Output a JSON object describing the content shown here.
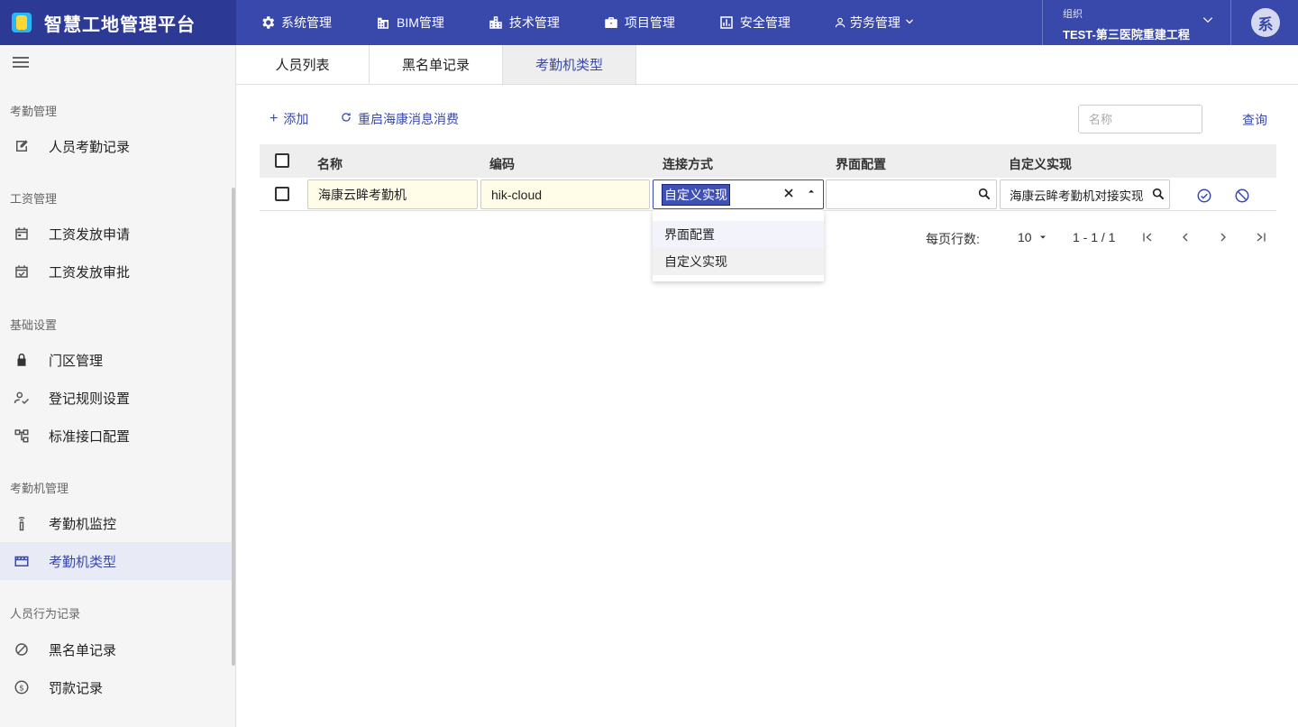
{
  "app": {
    "title": "智慧工地管理平台",
    "accent_color": "#3949ab",
    "user_avatar": "系"
  },
  "nav": {
    "items": [
      {
        "label": "系统管理",
        "icon": "gear-icon"
      },
      {
        "label": "BIM管理",
        "icon": "building-icon"
      },
      {
        "label": "技术管理",
        "icon": "city-icon"
      },
      {
        "label": "项目管理",
        "icon": "briefcase-icon"
      },
      {
        "label": "安全管理",
        "icon": "chart-box-icon"
      },
      {
        "label": "劳务管理",
        "icon": "person-icon"
      }
    ]
  },
  "org": {
    "label": "组织",
    "value": "TEST-第三医院重建工程"
  },
  "sidebar": {
    "groups": [
      {
        "title": "考勤管理",
        "items": [
          {
            "label": "人员考勤记录",
            "icon": "edit-note-icon"
          }
        ]
      },
      {
        "title": "工资管理",
        "items": [
          {
            "label": "工资发放申请",
            "icon": "calendar-icon"
          },
          {
            "label": "工资发放审批",
            "icon": "calendar-check-icon"
          }
        ]
      },
      {
        "title": "基础设置",
        "items": [
          {
            "label": "门区管理",
            "icon": "lock-icon"
          },
          {
            "label": "登记规则设置",
            "icon": "person-check-icon"
          },
          {
            "label": "标准接口配置",
            "icon": "tree-icon"
          }
        ]
      },
      {
        "title": "考勤机管理",
        "items": [
          {
            "label": "考勤机监控",
            "icon": "tower-icon"
          },
          {
            "label": "考勤机类型",
            "icon": "movie-icon",
            "active": true
          }
        ]
      },
      {
        "title": "人员行为记录",
        "items": [
          {
            "label": "黑名单记录",
            "icon": "block-icon"
          },
          {
            "label": "罚款记录",
            "icon": "dollar-icon"
          }
        ]
      }
    ]
  },
  "tabs": [
    {
      "label": "人员列表"
    },
    {
      "label": "黑名单记录"
    },
    {
      "label": "考勤机类型",
      "active": true
    }
  ],
  "toolbar": {
    "add_label": "添加",
    "restart_label": "重启海康消息消费",
    "search_placeholder": "名称",
    "query_label": "查询"
  },
  "table": {
    "columns": [
      "名称",
      "编码",
      "连接方式",
      "界面配置",
      "自定义实现"
    ],
    "row": {
      "name": "海康云眸考勤机",
      "code": "hik-cloud",
      "connection": "自定义实现",
      "ui_config": "",
      "custom_impl": "海康云眸考勤机对接实现"
    }
  },
  "dropdown": {
    "options": [
      "界面配置",
      "自定义实现"
    ]
  },
  "pagination": {
    "rows_per_page_label": "每页行数:",
    "rows_per_page": "10",
    "range": "1 - 1 / 1"
  }
}
